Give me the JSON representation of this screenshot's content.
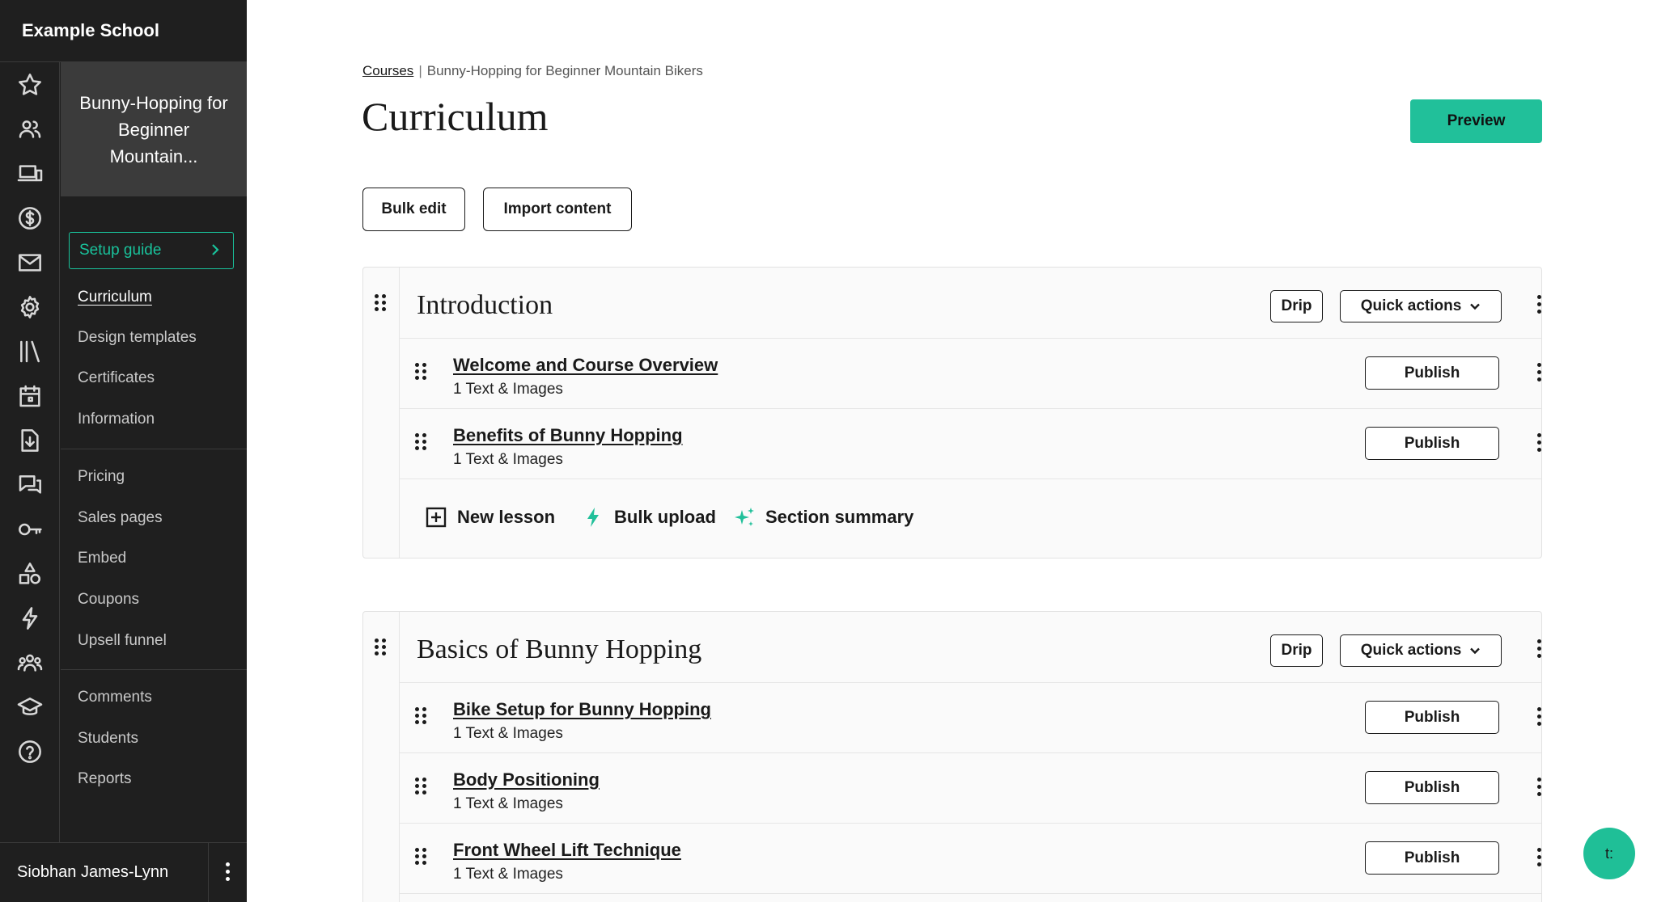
{
  "app": {
    "school_name": "Example School"
  },
  "sidebar": {
    "rail_icons": [
      "star-icon",
      "users-icon",
      "devices-icon",
      "dollar-icon",
      "mail-icon",
      "gear-icon",
      "library-icon",
      "calendar-icon",
      "download-doc-icon",
      "chat-icon",
      "key-icon",
      "shapes-icon",
      "lightning-icon",
      "community-icon",
      "graduation-icon",
      "help-icon"
    ],
    "course_title": "Bunny-Hopping for Beginner Mountain...",
    "setup_guide_label": "Setup guide",
    "nav_group_1": [
      "Curriculum",
      "Design templates",
      "Certificates",
      "Information"
    ],
    "nav_group_2": [
      "Pricing",
      "Sales pages",
      "Embed",
      "Coupons",
      "Upsell funnel"
    ],
    "nav_group_3": [
      "Comments",
      "Students",
      "Reports"
    ],
    "active_item": "Curriculum",
    "user_name": "Siobhan James-Lynn"
  },
  "header": {
    "breadcrumb_root": "Courses",
    "breadcrumb_separator": "|",
    "breadcrumb_current": "Bunny-Hopping for Beginner Mountain Bikers",
    "title": "Curriculum",
    "preview_label": "Preview",
    "bulk_edit_label": "Bulk edit",
    "import_content_label": "Import content"
  },
  "sections": [
    {
      "title": "Introduction",
      "drip_label": "Drip",
      "quick_actions_label": "Quick actions",
      "lessons": [
        {
          "title": "Welcome and Course Overview",
          "meta": "1 Text & Images",
          "publish_label": "Publish"
        },
        {
          "title": "Benefits of Bunny Hopping",
          "meta": "1 Text & Images",
          "publish_label": "Publish"
        }
      ],
      "actions": {
        "new_lesson": "New lesson",
        "bulk_upload": "Bulk upload",
        "section_summary": "Section summary"
      }
    },
    {
      "title": "Basics of Bunny Hopping",
      "drip_label": "Drip",
      "quick_actions_label": "Quick actions",
      "lessons": [
        {
          "title": "Bike Setup for Bunny Hopping",
          "meta": "1 Text & Images",
          "publish_label": "Publish"
        },
        {
          "title": "Body Positioning",
          "meta": "1 Text & Images",
          "publish_label": "Publish"
        },
        {
          "title": "Front Wheel Lift Technique",
          "meta": "1 Text & Images",
          "publish_label": "Publish"
        }
      ]
    }
  ],
  "chat": {
    "label": "t:"
  },
  "colors": {
    "accent": "#21c09a",
    "sidebar_bg": "#1f1f1f",
    "course_box_bg": "#3b3b3b"
  }
}
